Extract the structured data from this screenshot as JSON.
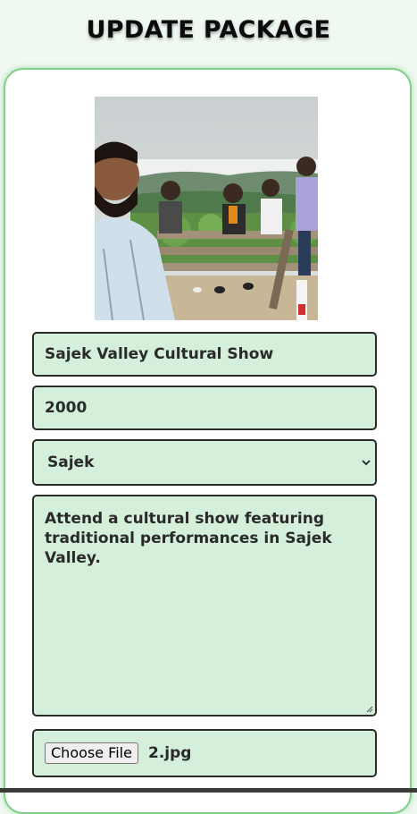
{
  "page": {
    "title": "UPDATE PACKAGE"
  },
  "form": {
    "image_alt": "group photo at Sajek hill viewpoint",
    "package_name": "Sajek Valley Cultural Show",
    "price": "2000",
    "location": "Sajek",
    "description": "Attend a cultural show featuring traditional performances in Sajek Valley.",
    "file_button_label": "Choose File",
    "file_name": "2.jpg"
  },
  "colors": {
    "page_bg": "#eff8f1",
    "card_border": "#7ed08a",
    "field_bg": "#d4efda",
    "field_border": "#2b2b2b"
  },
  "icons": {
    "select_arrow": "chevron-down-icon",
    "textarea_resize": "resize-grip-icon"
  }
}
